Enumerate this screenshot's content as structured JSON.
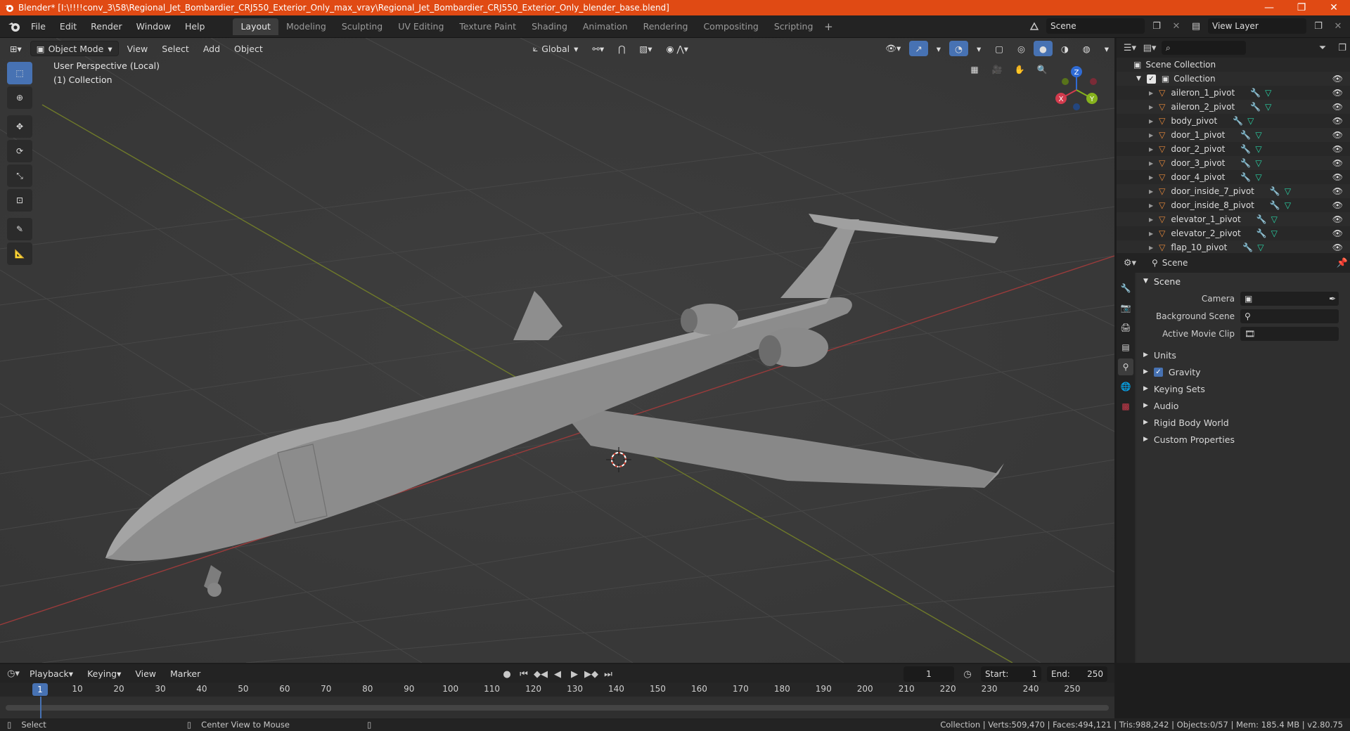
{
  "titlebar": {
    "title": "Blender* [I:\\!!!!conv_3\\58\\Regional_Jet_Bombardier_CRJ550_Exterior_Only_max_vray\\Regional_Jet_Bombardier_CRJ550_Exterior_Only_blender_base.blend]",
    "minimize": "—",
    "maximize": "❐",
    "close": "✕"
  },
  "menu": [
    "File",
    "Edit",
    "Render",
    "Window",
    "Help"
  ],
  "workspaces": [
    "Layout",
    "Modeling",
    "Sculpting",
    "UV Editing",
    "Texture Paint",
    "Shading",
    "Animation",
    "Rendering",
    "Compositing",
    "Scripting"
  ],
  "active_workspace": "Layout",
  "scene_field": "Scene",
  "view_layer_field": "View Layer",
  "viewport": {
    "mode": "Object Mode",
    "menus": [
      "View",
      "Select",
      "Add",
      "Object"
    ],
    "transform": "Global",
    "info_line1": "User Perspective (Local)",
    "info_line2": "(1) Collection",
    "gizmo": {
      "x": "X",
      "y": "Y",
      "z": "Z"
    }
  },
  "outliner": {
    "root": "Scene Collection",
    "collection": "Collection",
    "items": [
      {
        "name": "aileron_1_pivot"
      },
      {
        "name": "aileron_2_pivot"
      },
      {
        "name": "body_pivot"
      },
      {
        "name": "door_1_pivot"
      },
      {
        "name": "door_2_pivot"
      },
      {
        "name": "door_3_pivot"
      },
      {
        "name": "door_4_pivot"
      },
      {
        "name": "door_inside_7_pivot"
      },
      {
        "name": "door_inside_8_pivot"
      },
      {
        "name": "elevator_1_pivot"
      },
      {
        "name": "elevator_2_pivot"
      },
      {
        "name": "flap_10_pivot"
      }
    ]
  },
  "properties": {
    "header": "Scene",
    "panel": "Scene",
    "camera_label": "Camera",
    "background_label": "Background Scene",
    "movie_label": "Active Movie Clip",
    "subpanels": [
      "Units",
      "Gravity",
      "Keying Sets",
      "Audio",
      "Rigid Body World",
      "Custom Properties"
    ]
  },
  "timeline": {
    "menus": [
      "Playback",
      "Keying",
      "View",
      "Marker"
    ],
    "current_frame": "1",
    "start_label": "Start:",
    "start": "1",
    "end_label": "End:",
    "end": "250",
    "ticks": [
      "1",
      "10",
      "20",
      "30",
      "40",
      "50",
      "60",
      "70",
      "80",
      "90",
      "100",
      "110",
      "120",
      "130",
      "140",
      "150",
      "160",
      "170",
      "180",
      "190",
      "200",
      "210",
      "220",
      "230",
      "240",
      "250"
    ]
  },
  "status": {
    "left1": "Select",
    "left2": "Center View to Mouse",
    "right": "Collection | Verts:509,470 | Faces:494,121 | Tris:988,242 | Objects:0/57 | Mem: 185.4 MB | v2.80.75"
  },
  "colors": {
    "accent": "#4772b3",
    "titlebar": "#e04a14",
    "object_icon": "#e8893a",
    "mesh_icon": "#29d3a5"
  }
}
